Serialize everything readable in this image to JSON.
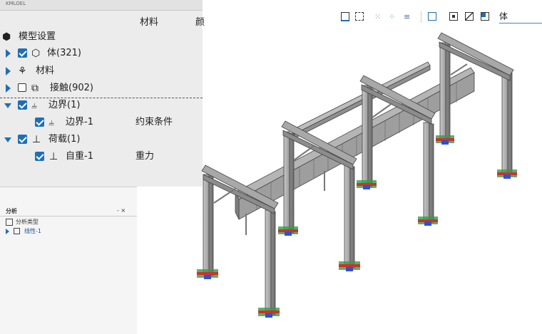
{
  "tree": {
    "topbar_text": "KMLOEL",
    "columns": [
      "材料",
      "颜"
    ],
    "root": "模型设置",
    "items": [
      {
        "label": "体(321)"
      },
      {
        "label": "材料"
      },
      {
        "label": "接触(902)"
      },
      {
        "label": "边界(1)"
      },
      {
        "label": "边界-1",
        "value": "约束条件"
      },
      {
        "label": "荷载(1)"
      },
      {
        "label": "自重-1",
        "value": "重力"
      }
    ]
  },
  "analysis": {
    "title": "分析",
    "header_controls": "- ×",
    "type_label": "分析类型",
    "item": "线性-1"
  },
  "toolbar": {
    "icons": [
      "select-box-icon",
      "select-window-icon",
      "select-node-icon",
      "select-element-icon",
      "select-face-icon",
      "view-fit-icon",
      "view-front-icon",
      "view-iso-icon",
      "view-color-icon"
    ],
    "search_text": "体",
    "accent": "#1e6fb8"
  }
}
